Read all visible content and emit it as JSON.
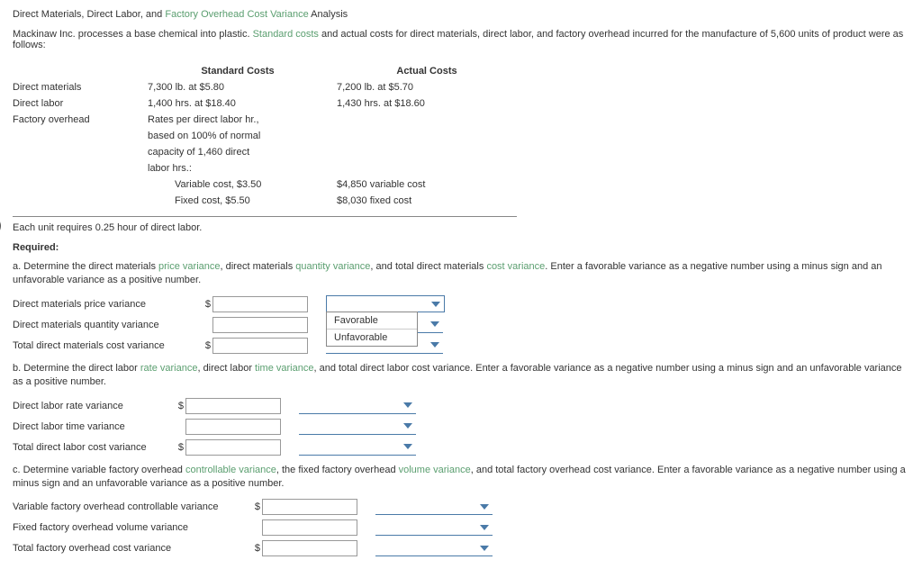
{
  "title": {
    "pre": "Direct Materials, Direct Labor, and ",
    "green": "Factory Overhead Cost Variance",
    "post": " Analysis"
  },
  "intro": {
    "pre": "Mackinaw Inc. processes a base chemical into plastic. ",
    "green": "Standard costs",
    "post": " and actual costs for direct materials, direct labor, and factory overhead incurred for the manufacture of 5,600 units of product were as follows:"
  },
  "costTable": {
    "hdrStd": "Standard Costs",
    "hdrAct": "Actual Costs",
    "rows": [
      {
        "name": "Direct materials",
        "std": "7,300 lb. at $5.80",
        "act": "7,200 lb. at $5.70"
      },
      {
        "name": "Direct labor",
        "std": "1,400 hrs. at $18.40",
        "act": "1,430 hrs. at $18.60"
      },
      {
        "name": "Factory overhead",
        "std": "Rates per direct labor hr.,",
        "act": ""
      }
    ],
    "stdExtra": [
      "based on 100% of normal",
      "capacity of 1,460 direct",
      "labor hrs.:"
    ],
    "detail": [
      {
        "std": "Variable cost, $3.50",
        "act": "$4,850 variable cost"
      },
      {
        "std": "Fixed cost, $5.50",
        "act": "$8,030 fixed cost"
      }
    ]
  },
  "eachUnit": "Each unit requires 0.25 hour of direct labor.",
  "required": "Required:",
  "a": {
    "pre": "a.  Determine the direct materials ",
    "g1": "price variance",
    "m1": ", direct materials ",
    "g2": "quantity variance",
    "m2": ", and total direct materials ",
    "g3": "cost variance",
    "post": ". Enter a favorable variance as a negative number using a minus sign and an unfavorable variance as a positive number.",
    "r1": "Direct materials price variance",
    "r2": "Direct materials quantity variance",
    "r3": "Total direct materials cost variance"
  },
  "b": {
    "pre": "b.  Determine the direct labor ",
    "g1": "rate variance",
    "m1": ", direct labor ",
    "g2": "time variance",
    "post": ", and total direct labor cost variance. Enter a favorable variance as a negative number using a minus sign and an unfavorable variance as a positive number.",
    "r1": "Direct labor rate variance",
    "r2": "Direct labor time variance",
    "r3": "Total direct labor cost variance"
  },
  "c": {
    "pre": "c.  Determine variable factory overhead ",
    "g1": "controllable variance",
    "m1": ", the fixed factory overhead ",
    "g2": "volume variance",
    "post": ", and total factory overhead cost variance. Enter a favorable variance as a negative number using a minus sign and an unfavorable variance as a positive number.",
    "r1": "Variable factory overhead controllable variance",
    "r2": "Fixed factory overhead volume variance",
    "r3": "Total factory overhead cost variance"
  },
  "ddopts": {
    "o1": "Favorable",
    "o2": "Unfavorable"
  }
}
